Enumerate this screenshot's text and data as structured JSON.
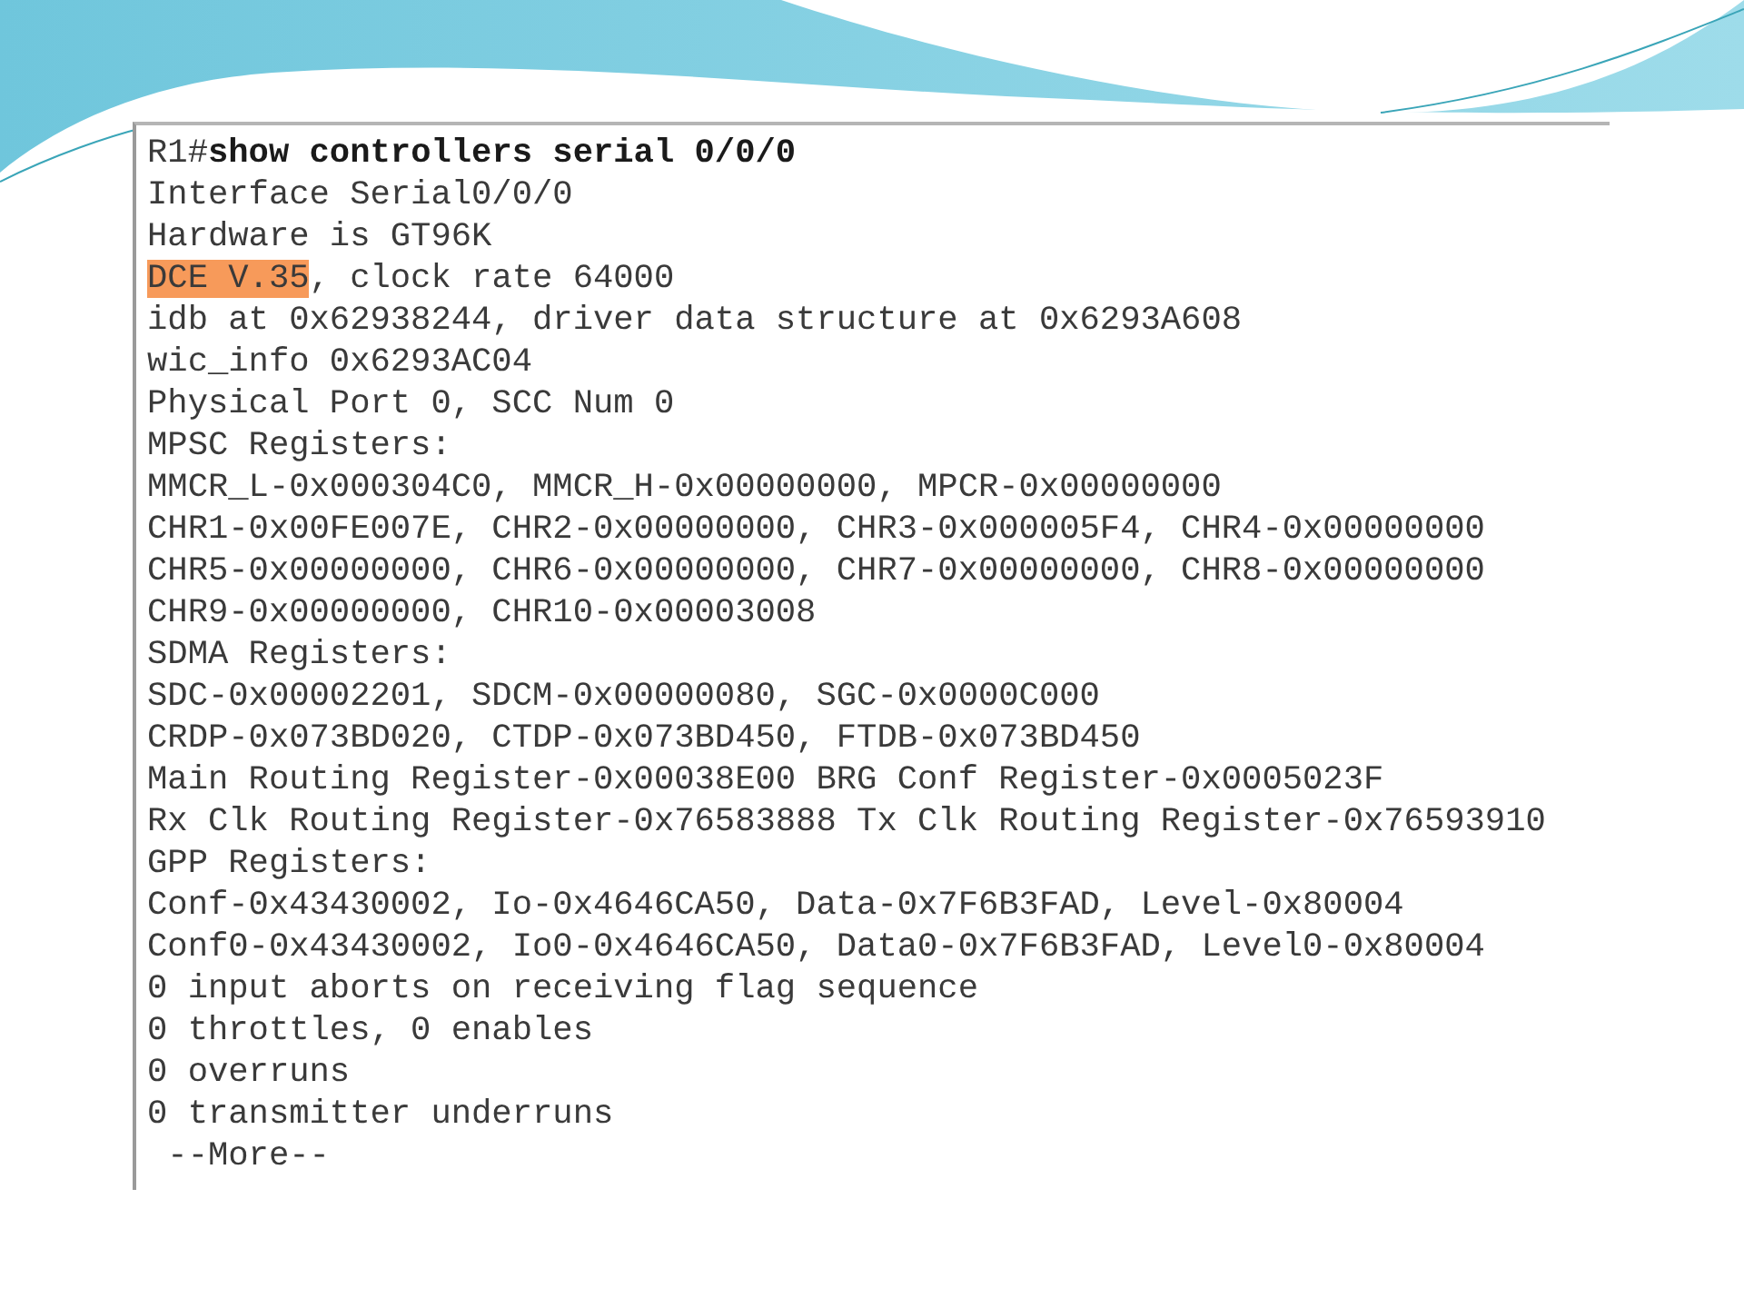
{
  "terminal": {
    "lines": [
      {
        "kind": "plain",
        "text": "R1#**show controllers serial 0/0/0**"
      },
      {
        "kind": "plain",
        "text": "Interface Serial0/0/0"
      },
      {
        "kind": "plain",
        "text": "Hardware is GT96K"
      },
      {
        "kind": "highlighted",
        "marked": "DCE V.35",
        "text": ", clock rate 64000"
      },
      {
        "kind": "plain",
        "text": "idb at 0x62938244, driver data structure at 0x6293A608"
      },
      {
        "kind": "plain",
        "text": "wic_info 0x6293AC04"
      },
      {
        "kind": "plain",
        "text": "Physical Port 0, SCC Num 0"
      },
      {
        "kind": "plain",
        "text": "MPSC Registers:"
      },
      {
        "kind": "plain",
        "text": "MMCR_L-0x000304C0, MMCR_H-0x00000000, MPCR-0x00000000"
      },
      {
        "kind": "plain",
        "text": "CHR1-0x00FE007E, CHR2-0x00000000, CHR3-0x000005F4, CHR4-0x00000000"
      },
      {
        "kind": "plain",
        "text": "CHR5-0x00000000, CHR6-0x00000000, CHR7-0x00000000, CHR8-0x00000000"
      },
      {
        "kind": "plain",
        "text": "CHR9-0x00000000, CHR10-0x00003008"
      },
      {
        "kind": "plain",
        "text": "SDMA Registers:"
      },
      {
        "kind": "plain",
        "text": "SDC-0x00002201, SDCM-0x00000080, SGC-0x0000C000"
      },
      {
        "kind": "plain",
        "text": "CRDP-0x073BD020, CTDP-0x073BD450, FTDB-0x073BD450"
      },
      {
        "kind": "plain",
        "text": "Main Routing Register-0x00038E00 BRG Conf Register-0x0005023F"
      },
      {
        "kind": "plain",
        "text": "Rx Clk Routing Register-0x76583888 Tx Clk Routing Register-0x76593910"
      },
      {
        "kind": "plain",
        "text": "GPP Registers:"
      },
      {
        "kind": "plain",
        "text": "Conf-0x43430002, Io-0x4646CA50, Data-0x7F6B3FAD, Level-0x80004"
      },
      {
        "kind": "plain",
        "text": "Conf0-0x43430002, Io0-0x4646CA50, Data0-0x7F6B3FAD, Level0-0x80004"
      },
      {
        "kind": "plain",
        "text": "0 input aborts on receiving flag sequence"
      },
      {
        "kind": "plain",
        "text": "0 throttles, 0 enables"
      },
      {
        "kind": "plain",
        "text": "0 overruns"
      },
      {
        "kind": "plain",
        "text": "0 transmitter underruns"
      },
      {
        "kind": "plain",
        "text": " --More--"
      }
    ]
  }
}
